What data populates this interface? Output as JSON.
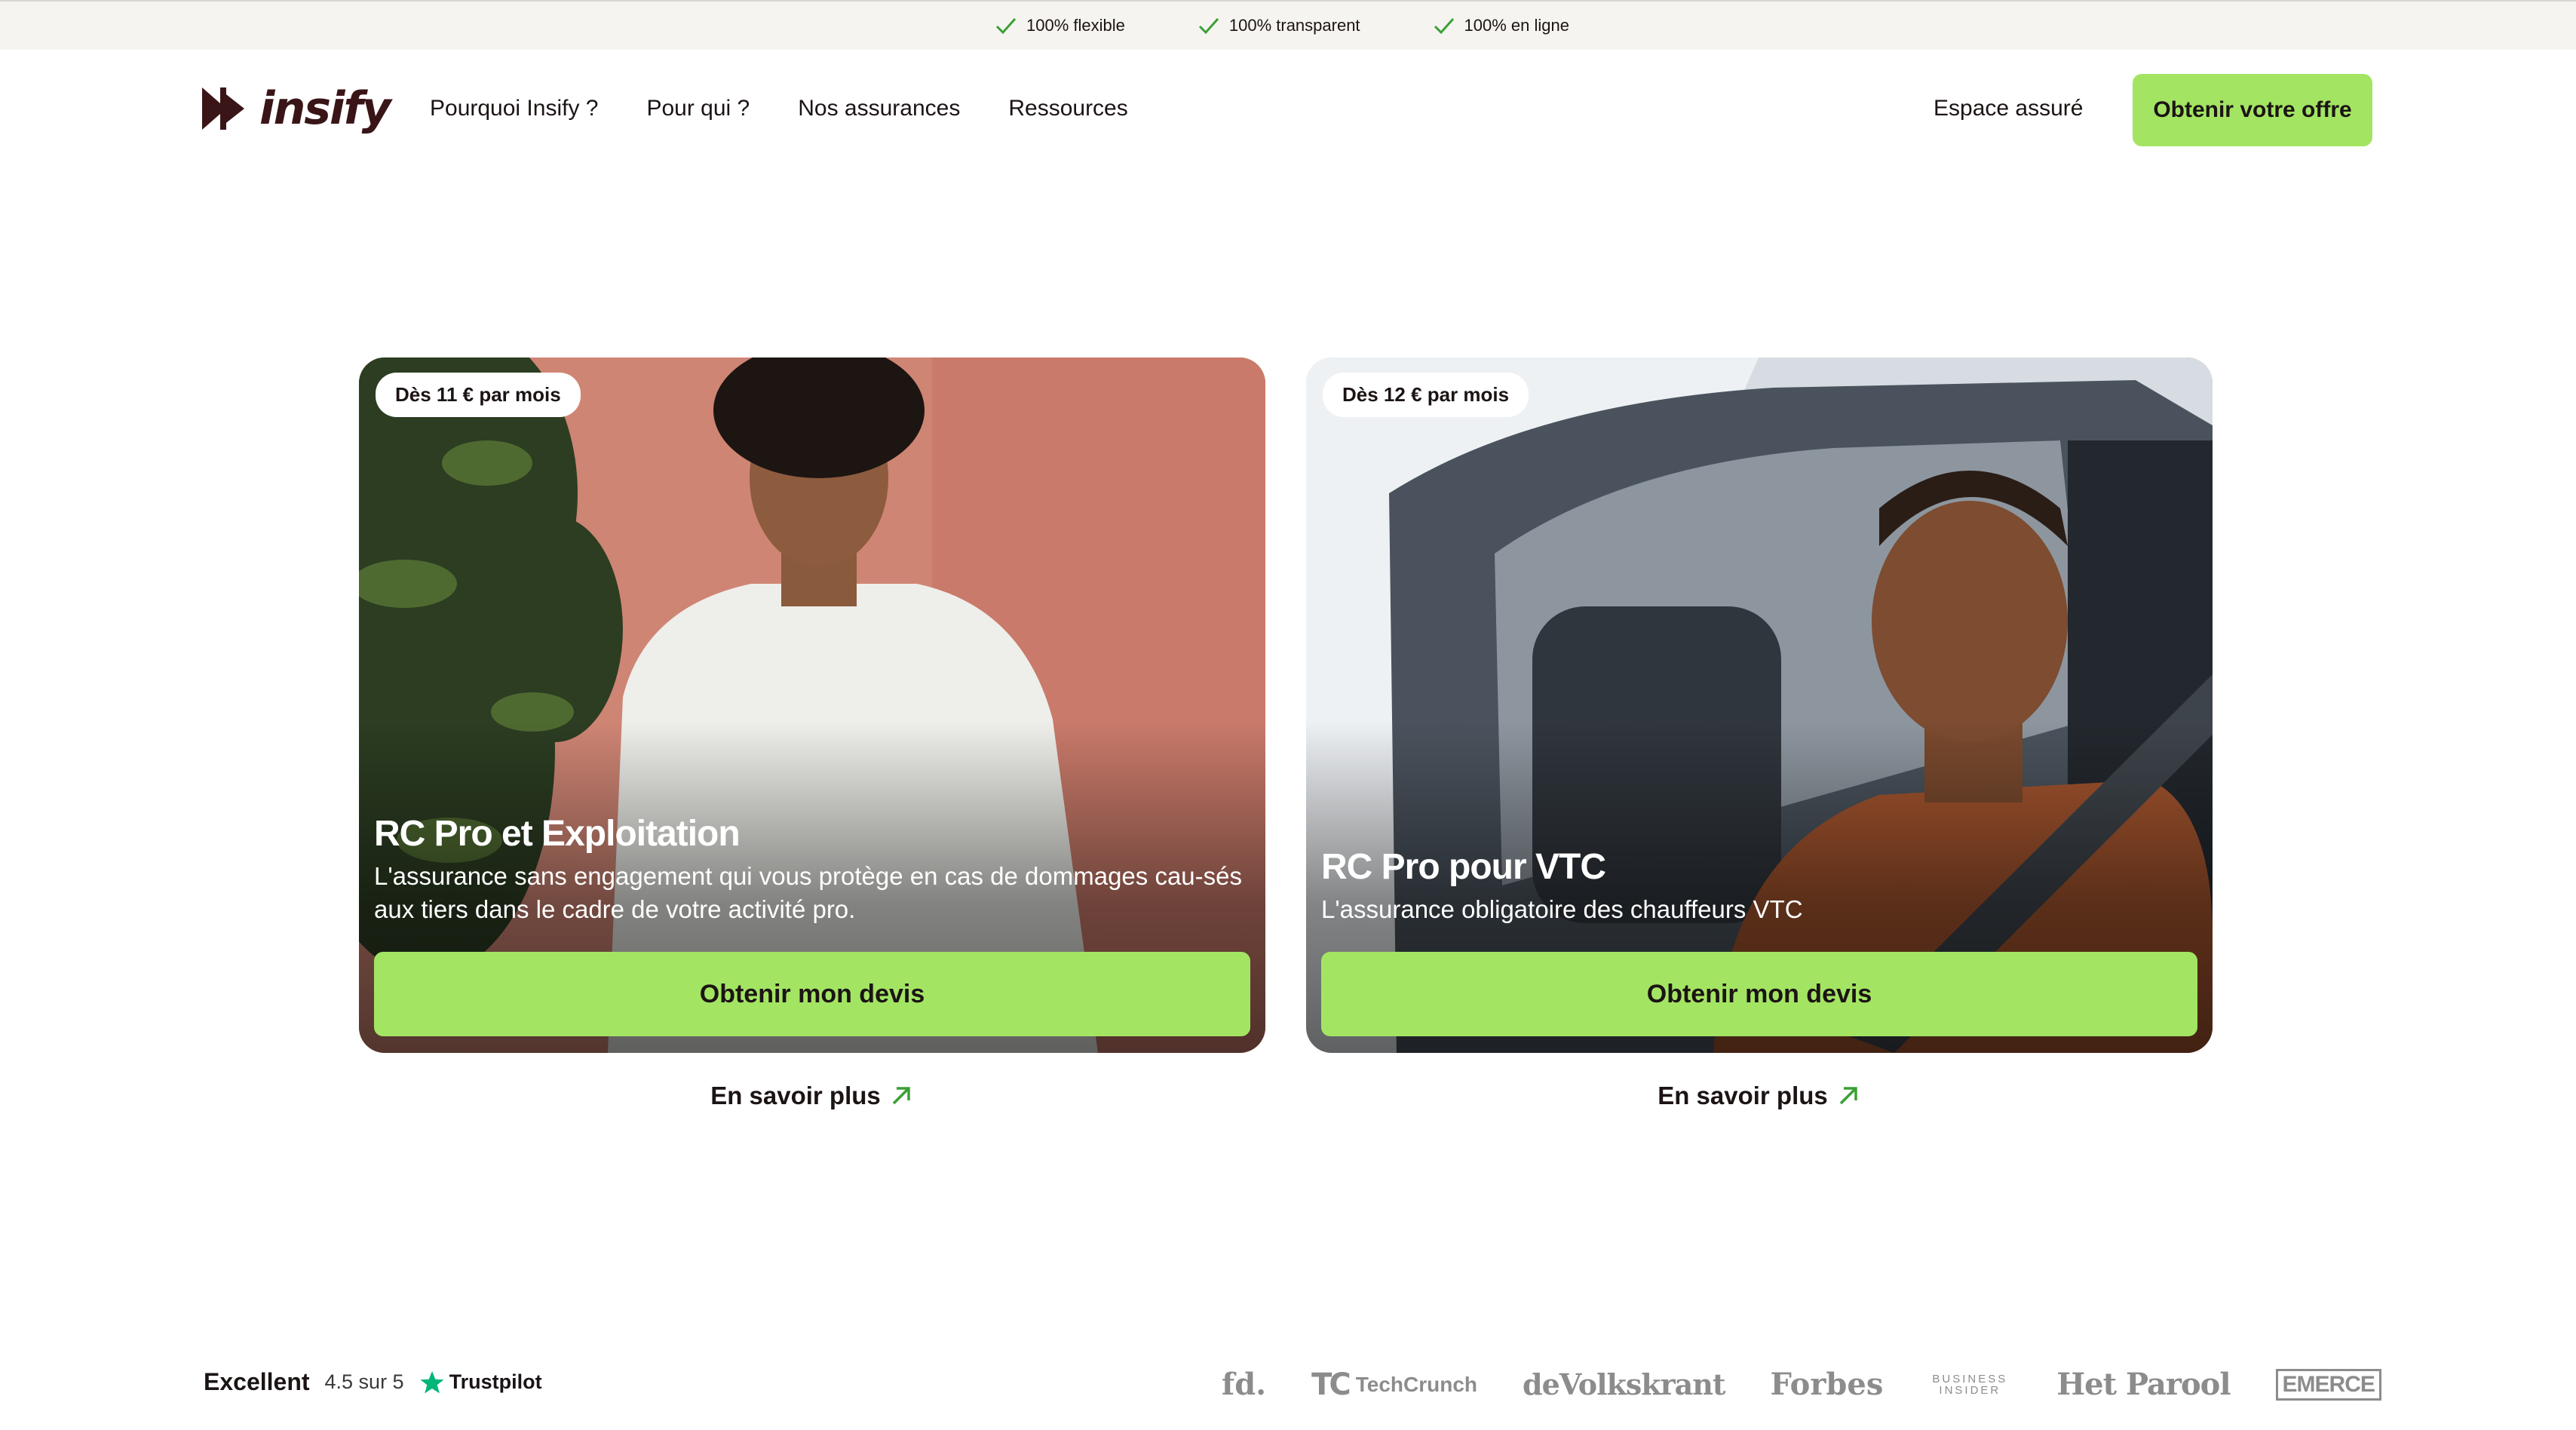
{
  "trust_bar": {
    "items": [
      "100% flexible",
      "100% transparent",
      "100% en ligne"
    ],
    "check_color": "#3aa035"
  },
  "header": {
    "logo_text": "insify",
    "nav": [
      "Pourquoi Insify ?",
      "Pour qui ?",
      "Nos assurances",
      "Ressources"
    ],
    "account_link": "Espace assuré",
    "cta_label": "Obtenir votre offre"
  },
  "cards": [
    {
      "badge": "Dès 11 € par mois",
      "title": "RC Pro et Exploitation",
      "description": "L'assurance sans engagement qui vous protège en cas de dommages cau-sés aux tiers dans le cadre de votre activité pro.",
      "button_label": "Obtenir mon devis",
      "learn_more": "En savoir plus"
    },
    {
      "badge": "Dès 12 € par mois",
      "title": "RC Pro pour VTC",
      "description": "L'assurance obligatoire des chauffeurs VTC",
      "button_label": "Obtenir mon devis",
      "learn_more": "En savoir plus"
    }
  ],
  "rating": {
    "label": "Excellent",
    "score": "4.5 sur 5",
    "provider": "Trustpilot",
    "star_color": "#00b67a"
  },
  "press_logos": [
    "fd.",
    "TechCrunch",
    "deVolkskrant",
    "Forbes",
    "BUSINESS INSIDER",
    "Het Parool",
    "EMERCE"
  ],
  "colors": {
    "accent": "#a3e563",
    "brand_dark": "#3a1517",
    "arrow": "#3aa035"
  }
}
